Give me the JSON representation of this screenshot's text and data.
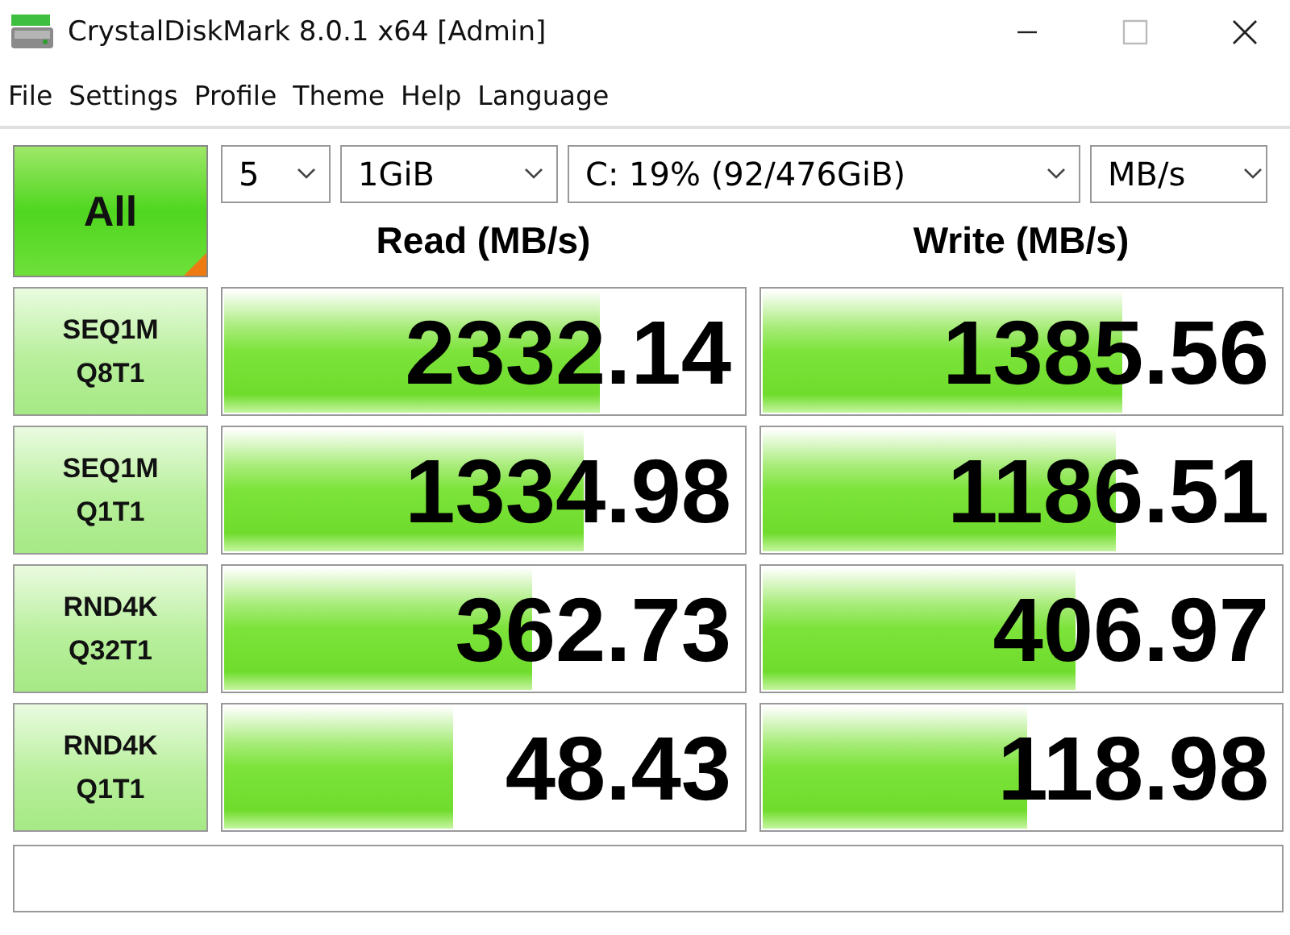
{
  "window": {
    "title": "CrystalDiskMark 8.0.1 x64 [Admin]"
  },
  "menu": [
    "File",
    "Settings",
    "Profile",
    "Theme",
    "Help",
    "Language"
  ],
  "all_button": {
    "label": "All"
  },
  "settings": {
    "count": "5",
    "size": "1GiB",
    "drive": "C: 19% (92/476GiB)",
    "unit": "MB/s"
  },
  "columns": [
    "Read (MB/s)",
    "Write (MB/s)"
  ],
  "tests": [
    {
      "name": "SEQ1M",
      "params": "Q8T1",
      "read": {
        "value": "2332.14",
        "level": 0.72
      },
      "write": {
        "value": "1385.56",
        "level": 0.69
      }
    },
    {
      "name": "SEQ1M",
      "params": "Q1T1",
      "read": {
        "value": "1334.98",
        "level": 0.69
      },
      "write": {
        "value": "1186.51",
        "level": 0.68
      }
    },
    {
      "name": "RND4K",
      "params": "Q32T1",
      "read": {
        "value": "362.73",
        "level": 0.59
      },
      "write": {
        "value": "406.97",
        "level": 0.6
      }
    },
    {
      "name": "RND4K",
      "params": "Q1T1",
      "read": {
        "value": "48.43",
        "level": 0.44
      },
      "write": {
        "value": "118.98",
        "level": 0.51
      }
    }
  ]
}
